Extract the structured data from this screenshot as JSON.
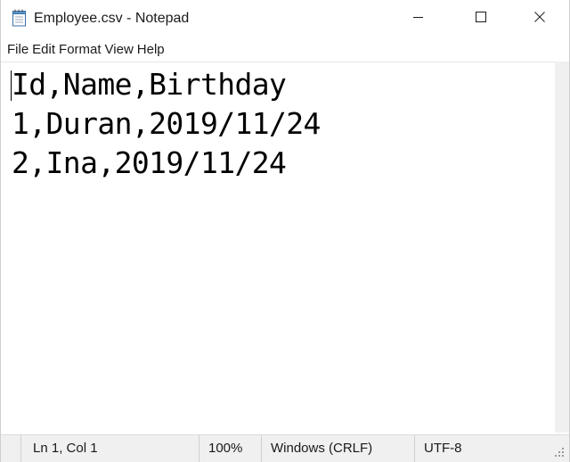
{
  "window": {
    "title": "Employee.csv - Notepad",
    "icons": {
      "app": "notepad-icon",
      "minimize": "minimize-icon",
      "maximize": "maximize-icon",
      "close": "close-icon"
    }
  },
  "menu": {
    "items": [
      {
        "label": "File"
      },
      {
        "label": "Edit"
      },
      {
        "label": "Format"
      },
      {
        "label": "View"
      },
      {
        "label": "Help"
      }
    ]
  },
  "editor": {
    "lines": [
      "Id,Name,Birthday",
      "1,Duran,2019/11/24",
      "2,Ina,2019/11/24"
    ]
  },
  "statusbar": {
    "position": "Ln 1, Col 1",
    "zoom": "100%",
    "line_ending": "Windows (CRLF)",
    "encoding": "UTF-8"
  }
}
